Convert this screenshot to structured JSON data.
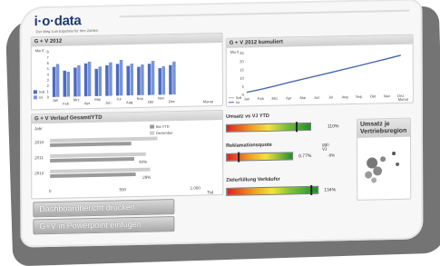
{
  "brand": {
    "logo": "i·o·data",
    "tagline": "Der Weg zum Ergebnis für Ihre Zahlen"
  },
  "panel_gv": {
    "title": "G + V 2012",
    "unit": "Mio €",
    "legend": [
      "Soll",
      "Ist"
    ]
  },
  "panel_gv_cum": {
    "title": "G + V 2012 kumuliert",
    "unit": "Mio €",
    "legend": [
      "Soll",
      "Ist"
    ],
    "xlabel": "Monat"
  },
  "panel_verlauf": {
    "title": "G + V Verlauf Gesamt/YTD",
    "year_label": "Jahr",
    "legend": [
      "Bis YTD",
      "Dezember"
    ],
    "unit_label": "Tsd"
  },
  "kpis": [
    {
      "title": "Umsatz vs VJ YTD",
      "value": "110%"
    },
    {
      "title": "Reklamationsquote",
      "extra": "ggü VJ",
      "value": "0,77%",
      "sub": "-9%"
    },
    {
      "title": "Zielerfüllung Verkäufer",
      "value": "134%"
    }
  ],
  "panel_region": {
    "title": "Umsatz je Vertriebsregion"
  },
  "buttons": {
    "print": "Dashboardbericht drucken",
    "ppt": "G+V in Powerpoint einfügen"
  },
  "chart_data": [
    {
      "type": "bar",
      "title": "G + V 2012",
      "ylabel": "Mio €",
      "xlabel": "Monat",
      "categories": [
        "Jan",
        "Feb",
        "Mrz",
        "Apr",
        "Mai",
        "Jun",
        "Jul",
        "Aug",
        "Sep",
        "Okt",
        "Nov",
        "Dez"
      ],
      "ylim": [
        0,
        8
      ],
      "tick_labels_y": [
        "0",
        "1",
        "2",
        "3",
        "4",
        "5",
        "6",
        "7",
        "8"
      ],
      "tick_labels_x": [
        "Feb",
        "Apr",
        "Jun",
        "Aug",
        "Okt",
        "Dez",
        "Jan",
        "Mrz",
        "Mai",
        "Jul",
        "Sep",
        "Nov"
      ],
      "series": [
        {
          "name": "Soll",
          "values": [
            5.3,
            4.6,
            5.1,
            5.8,
            4.8,
            5.4,
            5.6,
            5.2,
            5.0,
            5.5,
            4.7,
            5.2
          ]
        },
        {
          "name": "Ist",
          "values": [
            5.8,
            4.4,
            5.5,
            6.1,
            5.2,
            5.9,
            6.3,
            5.6,
            5.4,
            6.0,
            5.0,
            5.8
          ]
        }
      ],
      "colors": {
        "Soll": "#4a6cc4",
        "Ist": "#7b93d6"
      }
    },
    {
      "type": "line",
      "title": "G + V 2012 kumuliert",
      "ylabel": "Mio €",
      "xlabel": "Monat",
      "categories": [
        "Jan",
        "Feb",
        "Mrz",
        "Apr",
        "Mai",
        "Jun",
        "Jul",
        "Aug",
        "Sep",
        "Okt",
        "Nov",
        "Dez"
      ],
      "ylim": [
        0,
        25
      ],
      "tick_labels_y": [
        "0",
        "5",
        "10",
        "15",
        "20",
        "25"
      ],
      "series": [
        {
          "name": "Soll",
          "values": [
            1.5,
            3.2,
            5.0,
            7.0,
            8.8,
            10.6,
            12.4,
            14.2,
            16.0,
            17.8,
            19.6,
            21.5
          ]
        },
        {
          "name": "Ist",
          "values": [
            1.4,
            3.0,
            4.8,
            6.8,
            8.6,
            10.4,
            12.2,
            14.1,
            15.9,
            17.9,
            19.8,
            21.8
          ]
        }
      ],
      "colors": {
        "Soll": "#b0b0b0",
        "Ist": "#3f62b8"
      }
    },
    {
      "type": "bar",
      "title": "G + V Verlauf Gesamt/YTD",
      "orientation": "horizontal",
      "categories": [
        "2010",
        "2011",
        "2012"
      ],
      "series": [
        {
          "name": "Bis YTD",
          "values": [
            560,
            580,
            590
          ]
        },
        {
          "name": "Dezember",
          "values": [
            740,
            660,
            690
          ]
        }
      ],
      "tick_labels_x": [
        "0",
        "500",
        "1.000"
      ],
      "data_labels": [
        "40%",
        "29%"
      ],
      "colors": {
        "Bis YTD": "#9a9a9a",
        "Dezember": "#cfcfcf"
      }
    }
  ]
}
